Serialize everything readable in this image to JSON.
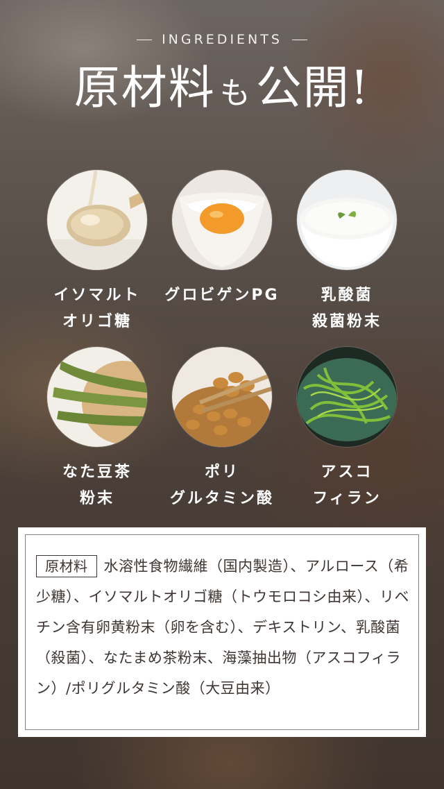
{
  "header": {
    "eyebrow": "INGREDIENTS",
    "title_part1": "原材料",
    "title_part2": "も",
    "title_part3": "公開!"
  },
  "ingredients": [
    {
      "label": "イソマルト\nオリゴ糖",
      "icon": "syrup-spoon-image"
    },
    {
      "label": "グロビゲンPG",
      "icon": "egg-yolk-image"
    },
    {
      "label": "乳酸菌\n殺菌粉末",
      "icon": "yogurt-bowl-image"
    },
    {
      "label": "なた豆茶\n粉末",
      "icon": "sword-bean-image"
    },
    {
      "label": "ポリ\nグルタミン酸",
      "icon": "natto-image"
    },
    {
      "label": "アスコ\nフィラン",
      "icon": "seaweed-image"
    }
  ],
  "raw_materials": {
    "tag": "原材料",
    "text": "水溶性食物繊維（国内製造）、アルロース（希少糖）、イソマルトオリゴ糖（トウモロコシ由来）、リベチン含有卵黄粉末（卵を含む）、デキストリン、乳酸菌（殺菌）、なたまめ茶粉末、海藻抽出物（アスコフィラン）/ポリグルタミン酸（大豆由来）"
  }
}
